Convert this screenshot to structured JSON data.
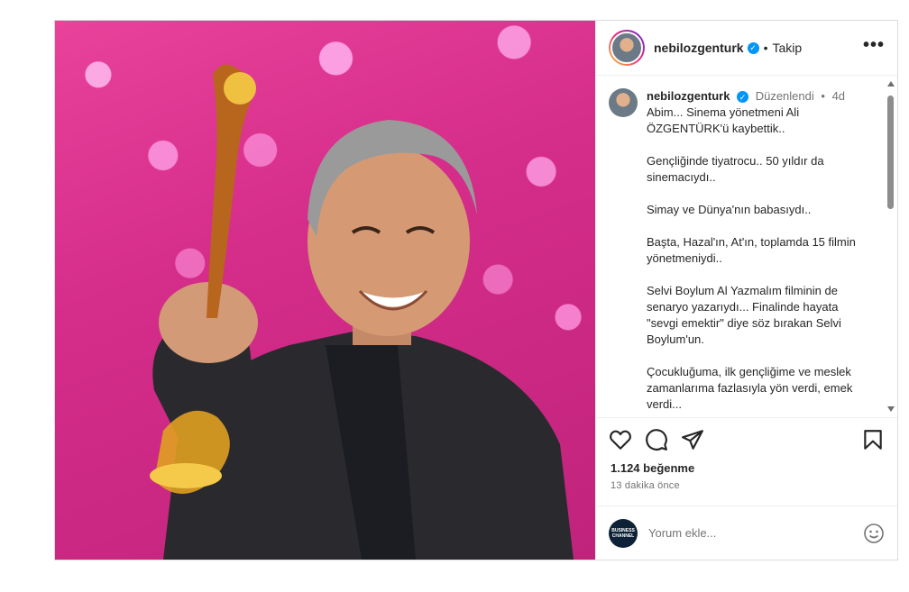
{
  "post": {
    "username": "nebilozgenturk",
    "follow_label": "Takip",
    "more_label": "•••",
    "separator": "•",
    "caption": {
      "username": "nebilozgenturk",
      "edited_label": "Düzenlendi",
      "separator": "•",
      "age": "4d",
      "paragraphs": [
        [
          "Abim... Sinema yönetmeni Ali",
          "ÖZGENTÜRK'ü kaybettik.."
        ],
        [
          "Gençliğinde tiyatrocu.. 50 yıldır da",
          "sinemacıydı.."
        ],
        [
          "Simay ve Dünya'nın babasıydı.."
        ],
        [
          "Başta, Hazal'ın, At'ın, toplamda 15 filmin",
          "yönetmeniydi.."
        ],
        [
          "Selvi Boylum Al Yazmalım filminin de",
          "senaryo yazarıydı... Finalinde hayata",
          "\"sevgi emektir\" diye söz bırakan Selvi",
          "Boylum'un."
        ],
        [
          "Çocukluğuma, ilk gençliğime ve meslek",
          "zamanlarıma fazlasıyla yön verdi, emek",
          "verdi..."
        ]
      ]
    },
    "likes": "1.124 beğenme",
    "time_ago": "13 dakika önce",
    "comment": {
      "placeholder": "Yorum ekle...",
      "avatar_text": [
        "BUSINESS",
        "CHANNEL"
      ]
    },
    "icons": {
      "like": "heart-icon",
      "comment": "comment-icon",
      "share": "share-icon",
      "save": "bookmark-icon",
      "emoji": "emoji-icon"
    }
  },
  "colors": {
    "verified": "#0095f6",
    "background_magenta": "#d52d8a",
    "muted_text": "#737373"
  }
}
